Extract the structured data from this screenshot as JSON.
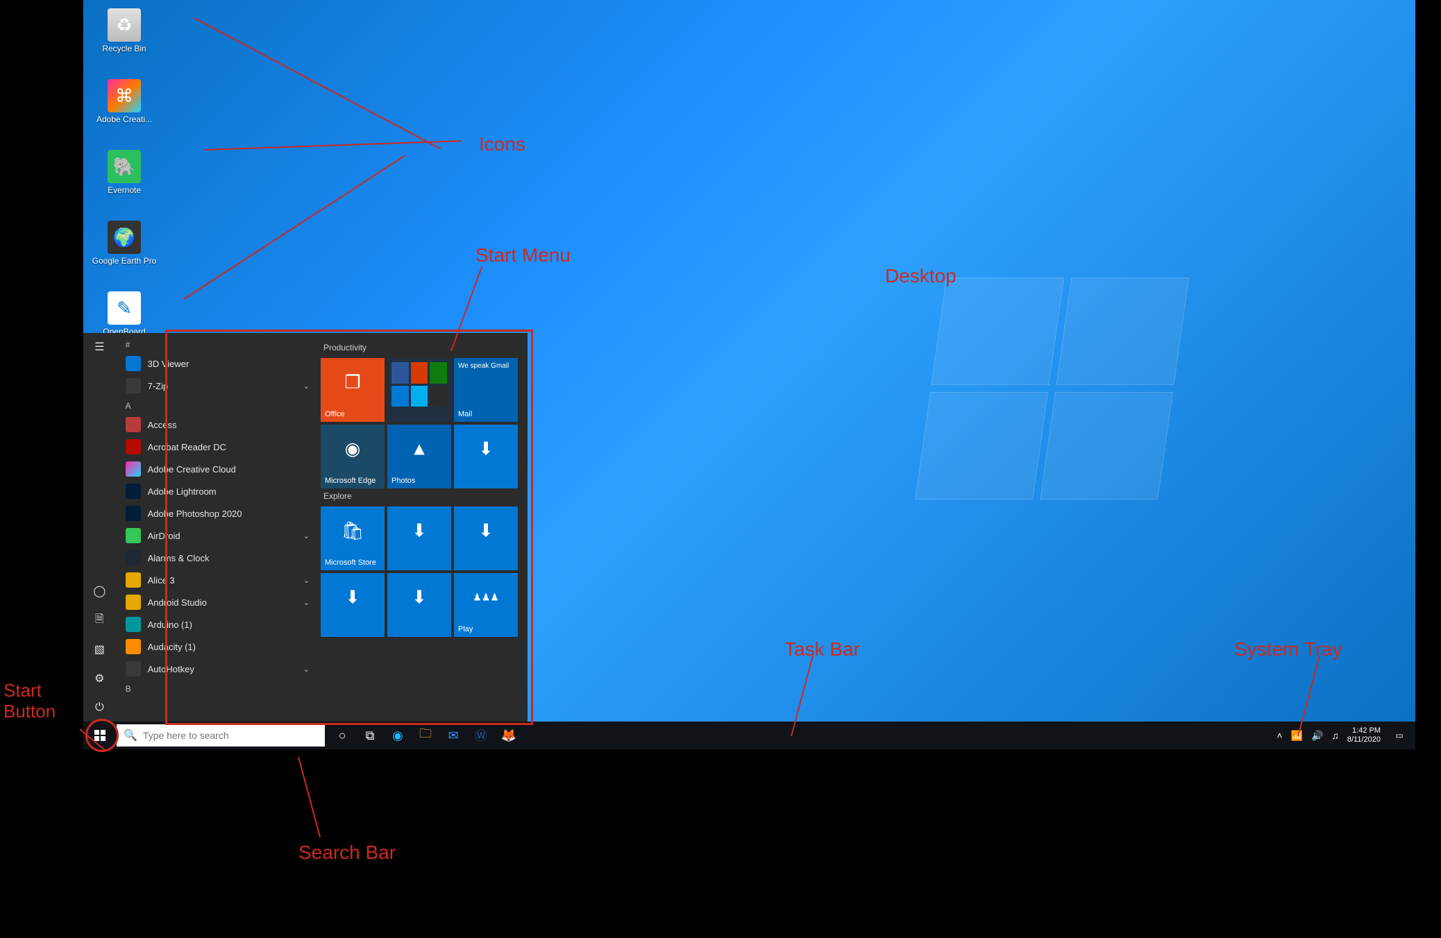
{
  "desktop_icons": [
    {
      "label": "Recycle Bin",
      "icon": "recycle"
    },
    {
      "label": "Adobe Creati...",
      "icon": "cc"
    },
    {
      "label": "Evernote",
      "icon": "evernote"
    },
    {
      "label": "Google Earth Pro",
      "icon": "earth"
    },
    {
      "label": "OpenBoard",
      "icon": "openboard"
    }
  ],
  "start_menu": {
    "group_header": "#",
    "apps": [
      {
        "label": "3D Viewer",
        "expandable": false
      },
      {
        "label": "7-Zip",
        "expandable": true
      },
      {
        "label": "Access",
        "expandable": false,
        "letter": "A"
      },
      {
        "label": "Acrobat Reader DC",
        "expandable": false
      },
      {
        "label": "Adobe Creative Cloud",
        "expandable": false
      },
      {
        "label": "Adobe Lightroom",
        "expandable": false
      },
      {
        "label": "Adobe Photoshop 2020",
        "expandable": false
      },
      {
        "label": "AirDroid",
        "expandable": true
      },
      {
        "label": "Alarms & Clock",
        "expandable": false
      },
      {
        "label": "Alice 3",
        "expandable": true
      },
      {
        "label": "Android Studio",
        "expandable": true
      },
      {
        "label": "Arduino (1)",
        "expandable": false
      },
      {
        "label": "Audacity (1)",
        "expandable": false
      },
      {
        "label": "AutoHotkey",
        "expandable": true
      }
    ],
    "next_letter": "B",
    "tiles": {
      "section1": "Productivity",
      "section2": "Explore",
      "office": "Office",
      "edge": "Microsoft Edge",
      "photos": "Photos",
      "mail": "Mail",
      "mail_sub": "We speak Gmail",
      "store": "Microsoft Store",
      "play": "Play"
    }
  },
  "search": {
    "placeholder": "Type here to search"
  },
  "tray": {
    "time": "1:42 PM",
    "date": "8/11/2020"
  },
  "annotations": {
    "icons": "Icons",
    "start_menu": "Start Menu",
    "desktop": "Desktop",
    "task_bar": "Task Bar",
    "system_tray": "System Tray",
    "start_button": "Start\nButton",
    "search_bar": "Search Bar"
  }
}
